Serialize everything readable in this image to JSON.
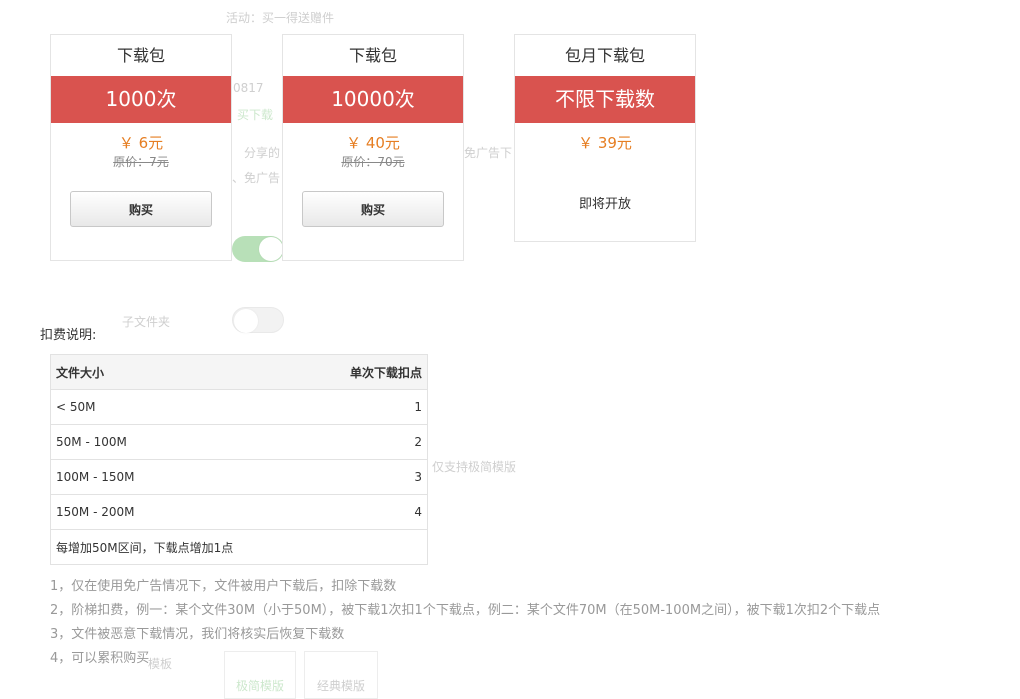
{
  "background": {
    "ghost_texts": [
      "活动：买一得送赠件",
      "0817",
      "买下载",
      "分享的",
      "免广告下",
      "、免广告",
      "子文件夹",
      "仅支持极简模版",
      "模板",
      "极简模版",
      "经典模版"
    ]
  },
  "packages": [
    {
      "title": "下载包",
      "band": "1000次",
      "price": "￥ 6元",
      "original": "原价：7元",
      "button": "购买"
    },
    {
      "title": "下载包",
      "band": "10000次",
      "price": "￥ 40元",
      "original": "原价：70元",
      "button": "购买"
    },
    {
      "title": "包月下载包",
      "band": "不限下载数",
      "price": "￥ 39元",
      "status": "即将开放"
    }
  ],
  "fee": {
    "label": "扣费说明:",
    "headers": [
      "文件大小",
      "单次下载扣点"
    ],
    "rows": [
      {
        "size": "< 50M",
        "points": "1"
      },
      {
        "size": "50M - 100M",
        "points": "2"
      },
      {
        "size": "100M - 150M",
        "points": "3"
      },
      {
        "size": "150M - 200M",
        "points": "4"
      }
    ],
    "footer": "每增加50M区间，下载点增加1点"
  },
  "notes": [
    "1，仅在使用免广告情况下，文件被用户下载后，扣除下载数",
    "2，阶梯扣费，例一：某个文件30M（小于50M），被下载1次扣1个下载点，例二：某个文件70M（在50M-100M之间），被下载1次扣2个下载点",
    "3，文件被恶意下载情况，我们将核实后恢复下载数",
    "4，可以累积购买"
  ],
  "colors": {
    "band": "#d9534f",
    "price": "#e67e22",
    "background_toggle_on": "#b8e0b8"
  }
}
